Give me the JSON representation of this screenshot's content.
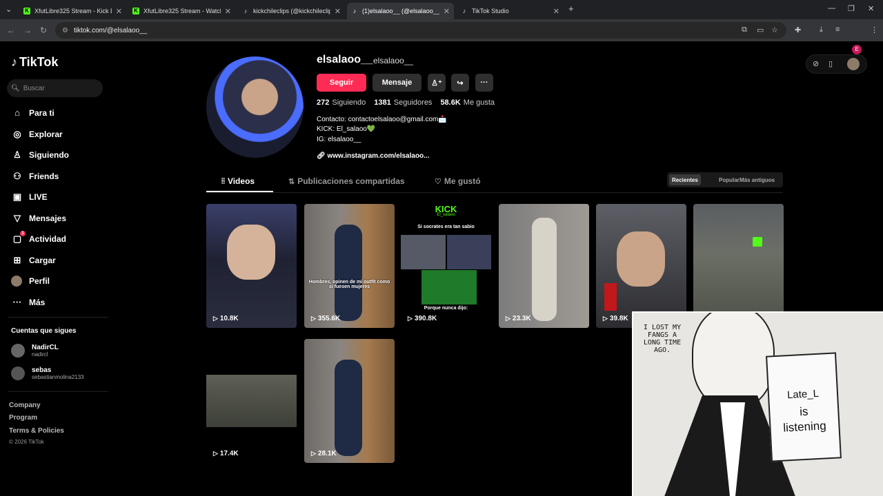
{
  "browser": {
    "tabs": [
      {
        "label": "XfutLibre325 Stream - Kick Das",
        "icon": "kick"
      },
      {
        "label": "XfutLibre325 Stream - Watch Li",
        "icon": "kick"
      },
      {
        "label": "kickchileclips (@kickchileclips)",
        "icon": "tiktok"
      },
      {
        "label": "(1)elsalaoo__ (@elsalaoo__) | Tik",
        "icon": "tiktok"
      },
      {
        "label": "TikTok Studio",
        "icon": "tiktok"
      }
    ],
    "url": "tiktok.com/@elsalaoo__",
    "profile_initial": "E"
  },
  "sidebar": {
    "logo": "TikTok",
    "search_placeholder": "Buscar",
    "items": [
      {
        "label": "Para ti",
        "icon": "home-icon"
      },
      {
        "label": "Explorar",
        "icon": "compass-icon"
      },
      {
        "label": "Siguiendo",
        "icon": "user-follow-icon"
      },
      {
        "label": "Friends",
        "icon": "friends-icon"
      },
      {
        "label": "LIVE",
        "icon": "live-icon"
      },
      {
        "label": "Mensajes",
        "icon": "message-icon"
      },
      {
        "label": "Actividad",
        "icon": "activity-icon",
        "badge": "1"
      },
      {
        "label": "Cargar",
        "icon": "upload-icon"
      },
      {
        "label": "Perfil",
        "icon": "avatar"
      },
      {
        "label": "Más",
        "icon": "more-icon"
      }
    ],
    "following_title": "Cuentas que sigues",
    "following": [
      {
        "name": "NadirCL",
        "handle": "nadircl"
      },
      {
        "name": "sebas",
        "handle": "sebastianmolina2133"
      }
    ],
    "footer": [
      "Company",
      "Program",
      "Terms & Policies"
    ],
    "copyright": "© 2026 TikTok"
  },
  "profile": {
    "username": "elsalaoo__",
    "nickname": "elsalaoo__",
    "follow_label": "Seguir",
    "message_label": "Mensaje",
    "following_count": "272",
    "following_label": "Siguiendo",
    "followers_count": "1381",
    "followers_label": "Seguidores",
    "likes_count": "58.6K",
    "likes_label": "Me gusta",
    "bio": [
      "Contacto: contactoelsalaoo@gmail.com📩",
      "KICK: El_salaoo💚",
      "IG: elsalaoo__"
    ],
    "link": "www.instagram.com/elsalaoo..."
  },
  "tabs": {
    "videos": "Videos",
    "reposts": "Publicaciones compartidas",
    "liked": "Me gustó"
  },
  "sort": {
    "recent": "Recientes",
    "popular": "Popular",
    "oldest": "Más antiguos"
  },
  "videos": [
    {
      "views": "10.8K"
    },
    {
      "views": "355.6K",
      "caption": "Hombres, opinen de mi outfit como si fuesen mujeres"
    },
    {
      "views": "390.8K",
      "kick": "KICK",
      "kick_sub": "El_salaoo",
      "top": "Si socrates era tan sabio",
      "bottom": "Porque nunca dijo:"
    },
    {
      "views": "23.3K"
    },
    {
      "views": "39.8K"
    },
    {
      "views": ""
    },
    {
      "views": "17.4K"
    },
    {
      "views": "28.1K"
    }
  ],
  "overlay": {
    "bubble": "I LOST MY FANGS A LONG TIME AGO.",
    "note_line1": "Late_L",
    "note_line2": "is",
    "note_line3": "listening"
  }
}
